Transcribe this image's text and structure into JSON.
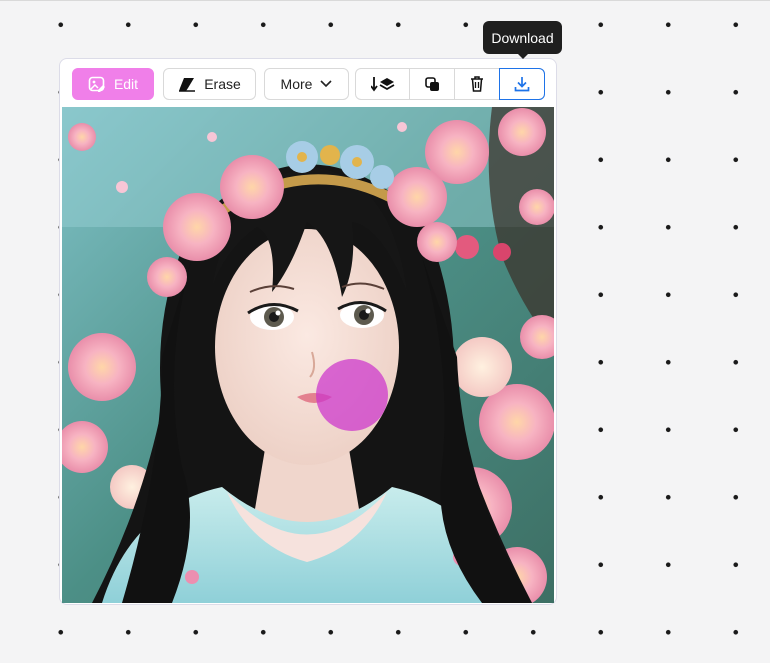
{
  "toolbar": {
    "edit_label": "Edit",
    "erase_label": "Erase",
    "more_label": "More",
    "icons": [
      "layer-down-icon",
      "copy-icon",
      "trash-icon",
      "download-icon"
    ]
  },
  "tooltip": {
    "text": "Download"
  },
  "colors": {
    "edit_accent": "#f07fe9",
    "selected_border": "#1e73e8",
    "cursor_highlight": "#cc33cc"
  }
}
